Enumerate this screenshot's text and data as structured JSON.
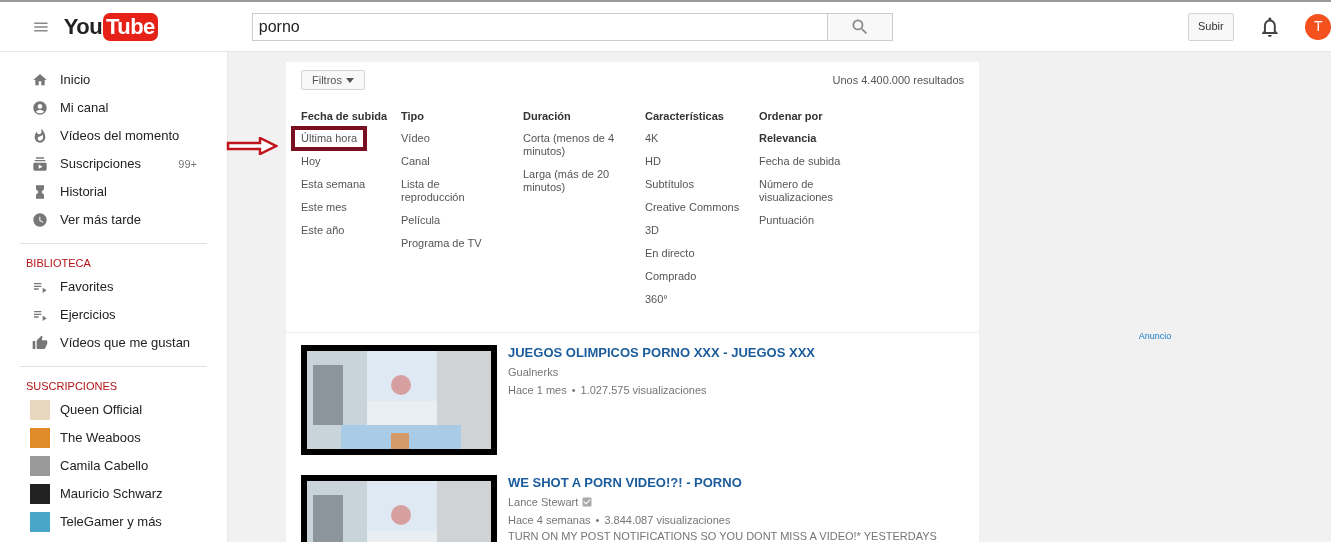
{
  "header": {
    "logo": {
      "left": "You",
      "right": "Tube"
    },
    "search": {
      "value": "porno"
    },
    "upload_button": "Subir",
    "avatar_letter": "T"
  },
  "sidebar": {
    "main": [
      {
        "label": "Inicio"
      },
      {
        "label": "Mi canal"
      },
      {
        "label": "Vídeos del momento"
      },
      {
        "label": "Suscripciones",
        "badge": "99+"
      },
      {
        "label": "Historial"
      },
      {
        "label": "Ver más tarde"
      }
    ],
    "library_title": "BIBLIOTECA",
    "library": [
      {
        "label": "Favorites",
        "kind": "playlist"
      },
      {
        "label": "Ejercicios",
        "kind": "playlist"
      },
      {
        "label": "Vídeos que me gustan",
        "kind": "liked"
      }
    ],
    "subscriptions_title": "SUSCRIPCIONES",
    "subscriptions": [
      {
        "label": "Queen Official",
        "color": "#e8d8c0"
      },
      {
        "label": "The Weaboos",
        "color": "#e08a2a"
      },
      {
        "label": "Camila Cabello",
        "color": "#9a9a9a"
      },
      {
        "label": "Mauricio Schwarz",
        "color": "#222222"
      },
      {
        "label": "TeleGamer y más",
        "color": "#4aa6c8"
      }
    ]
  },
  "filters": {
    "button": "Filtros",
    "results": "Unos 4.400.000 resultados",
    "columns": [
      {
        "heading": "Fecha de subida",
        "items": [
          {
            "label": "Última hora",
            "selected": false,
            "highlighted": true
          },
          {
            "label": "Hoy",
            "selected": false
          },
          {
            "label": "Esta semana",
            "selected": false
          },
          {
            "label": "Este mes",
            "selected": false
          },
          {
            "label": "Este año",
            "selected": false
          }
        ]
      },
      {
        "heading": "Tipo",
        "items": [
          {
            "label": "Vídeo",
            "selected": false
          },
          {
            "label": "Canal",
            "selected": false
          },
          {
            "label": "Lista de reproducción",
            "selected": false
          },
          {
            "label": "Película",
            "selected": false
          },
          {
            "label": "Programa de TV",
            "selected": false
          }
        ]
      },
      {
        "heading": "Duración",
        "items": [
          {
            "label": "Corta (menos de 4 minutos)",
            "selected": false
          },
          {
            "label": "Larga (más de 20 minutos)",
            "selected": false
          }
        ]
      },
      {
        "heading": "Características",
        "items": [
          {
            "label": "4K",
            "selected": false
          },
          {
            "label": "HD",
            "selected": false
          },
          {
            "label": "Subtítulos",
            "selected": false
          },
          {
            "label": "Creative Commons",
            "selected": false
          },
          {
            "label": "3D",
            "selected": false
          },
          {
            "label": "En directo",
            "selected": false
          },
          {
            "label": "Comprado",
            "selected": false
          },
          {
            "label": "360°",
            "selected": false
          }
        ]
      },
      {
        "heading": "Ordenar por",
        "items": [
          {
            "label": "Relevancia",
            "selected": true
          },
          {
            "label": "Fecha de subida",
            "selected": false
          },
          {
            "label": "Número de visualizaciones",
            "selected": false
          },
          {
            "label": "Puntuación",
            "selected": false
          }
        ]
      }
    ]
  },
  "results": [
    {
      "title": "JUEGOS OLIMPICOS PORNO XXX - JUEGOS XXX",
      "channel": "Gualnerks",
      "verified": false,
      "age": "Hace 1 mes",
      "separator": "•",
      "views": "1.027.575 visualizaciones"
    },
    {
      "title": "WE SHOT A PORN VIDEO!?! - PORNO",
      "channel": "Lance Stewart",
      "verified": true,
      "age": "Hace 4 semanas",
      "separator": "•",
      "views": "3.844.087 visualizaciones",
      "description": "TURN ON MY POST NOTIFICATIONS SO YOU DONT MISS A VIDEO!* YESTERDAYS"
    }
  ],
  "ad_label": "Anuncio"
}
